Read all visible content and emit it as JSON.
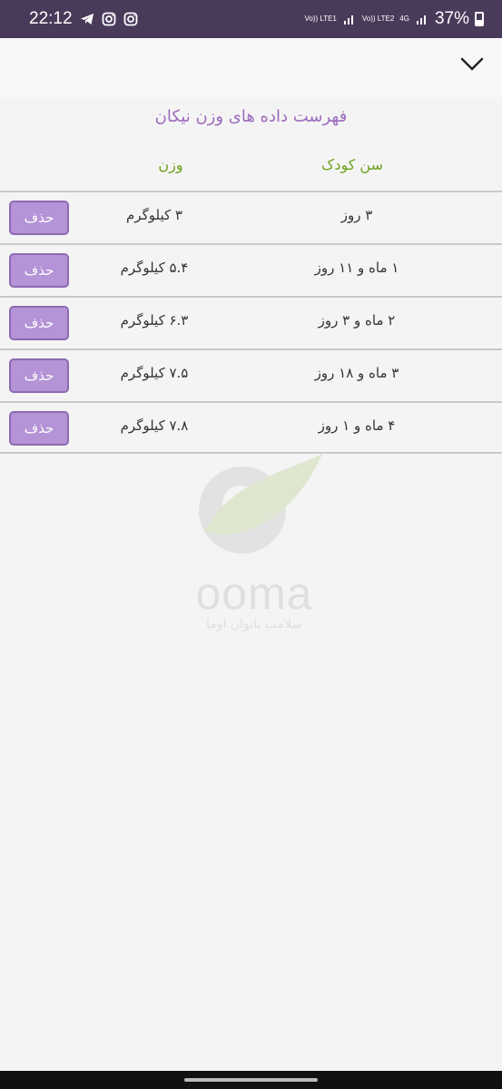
{
  "status_bar": {
    "time": "22:12",
    "net1": "Vo)) LTE1",
    "net2": "Vo)) LTE2",
    "net3": "4G",
    "battery": "37%"
  },
  "header": {
    "collapse_icon": "chevron-down-icon"
  },
  "page": {
    "title": "فهرست داده های وزن نیکان",
    "col_age": "سن کودک",
    "col_weight": "وزن"
  },
  "rows": [
    {
      "age": "۳ روز",
      "weight": "۳ کیلوگرم",
      "delete": "حذف"
    },
    {
      "age": "۱ ماه و ۱۱ روز",
      "weight": "۵.۴ کیلوگرم",
      "delete": "حذف"
    },
    {
      "age": "۲ ماه و ۳ روز",
      "weight": "۶.۳ کیلوگرم",
      "delete": "حذف"
    },
    {
      "age": "۳ ماه و ۱۸ روز",
      "weight": "۷.۵ کیلوگرم",
      "delete": "حذف"
    },
    {
      "age": "۴ ماه و ۱ روز",
      "weight": "۷.۸ کیلوگرم",
      "delete": "حذف"
    }
  ],
  "watermark": {
    "brand": "ooma",
    "subtitle": "سلامت بانوان اوما"
  },
  "colors": {
    "status_bar": "#4a3a5a",
    "title": "#9b6bbd",
    "header_text": "#6ea21c",
    "button_bg": "#b493d6"
  }
}
